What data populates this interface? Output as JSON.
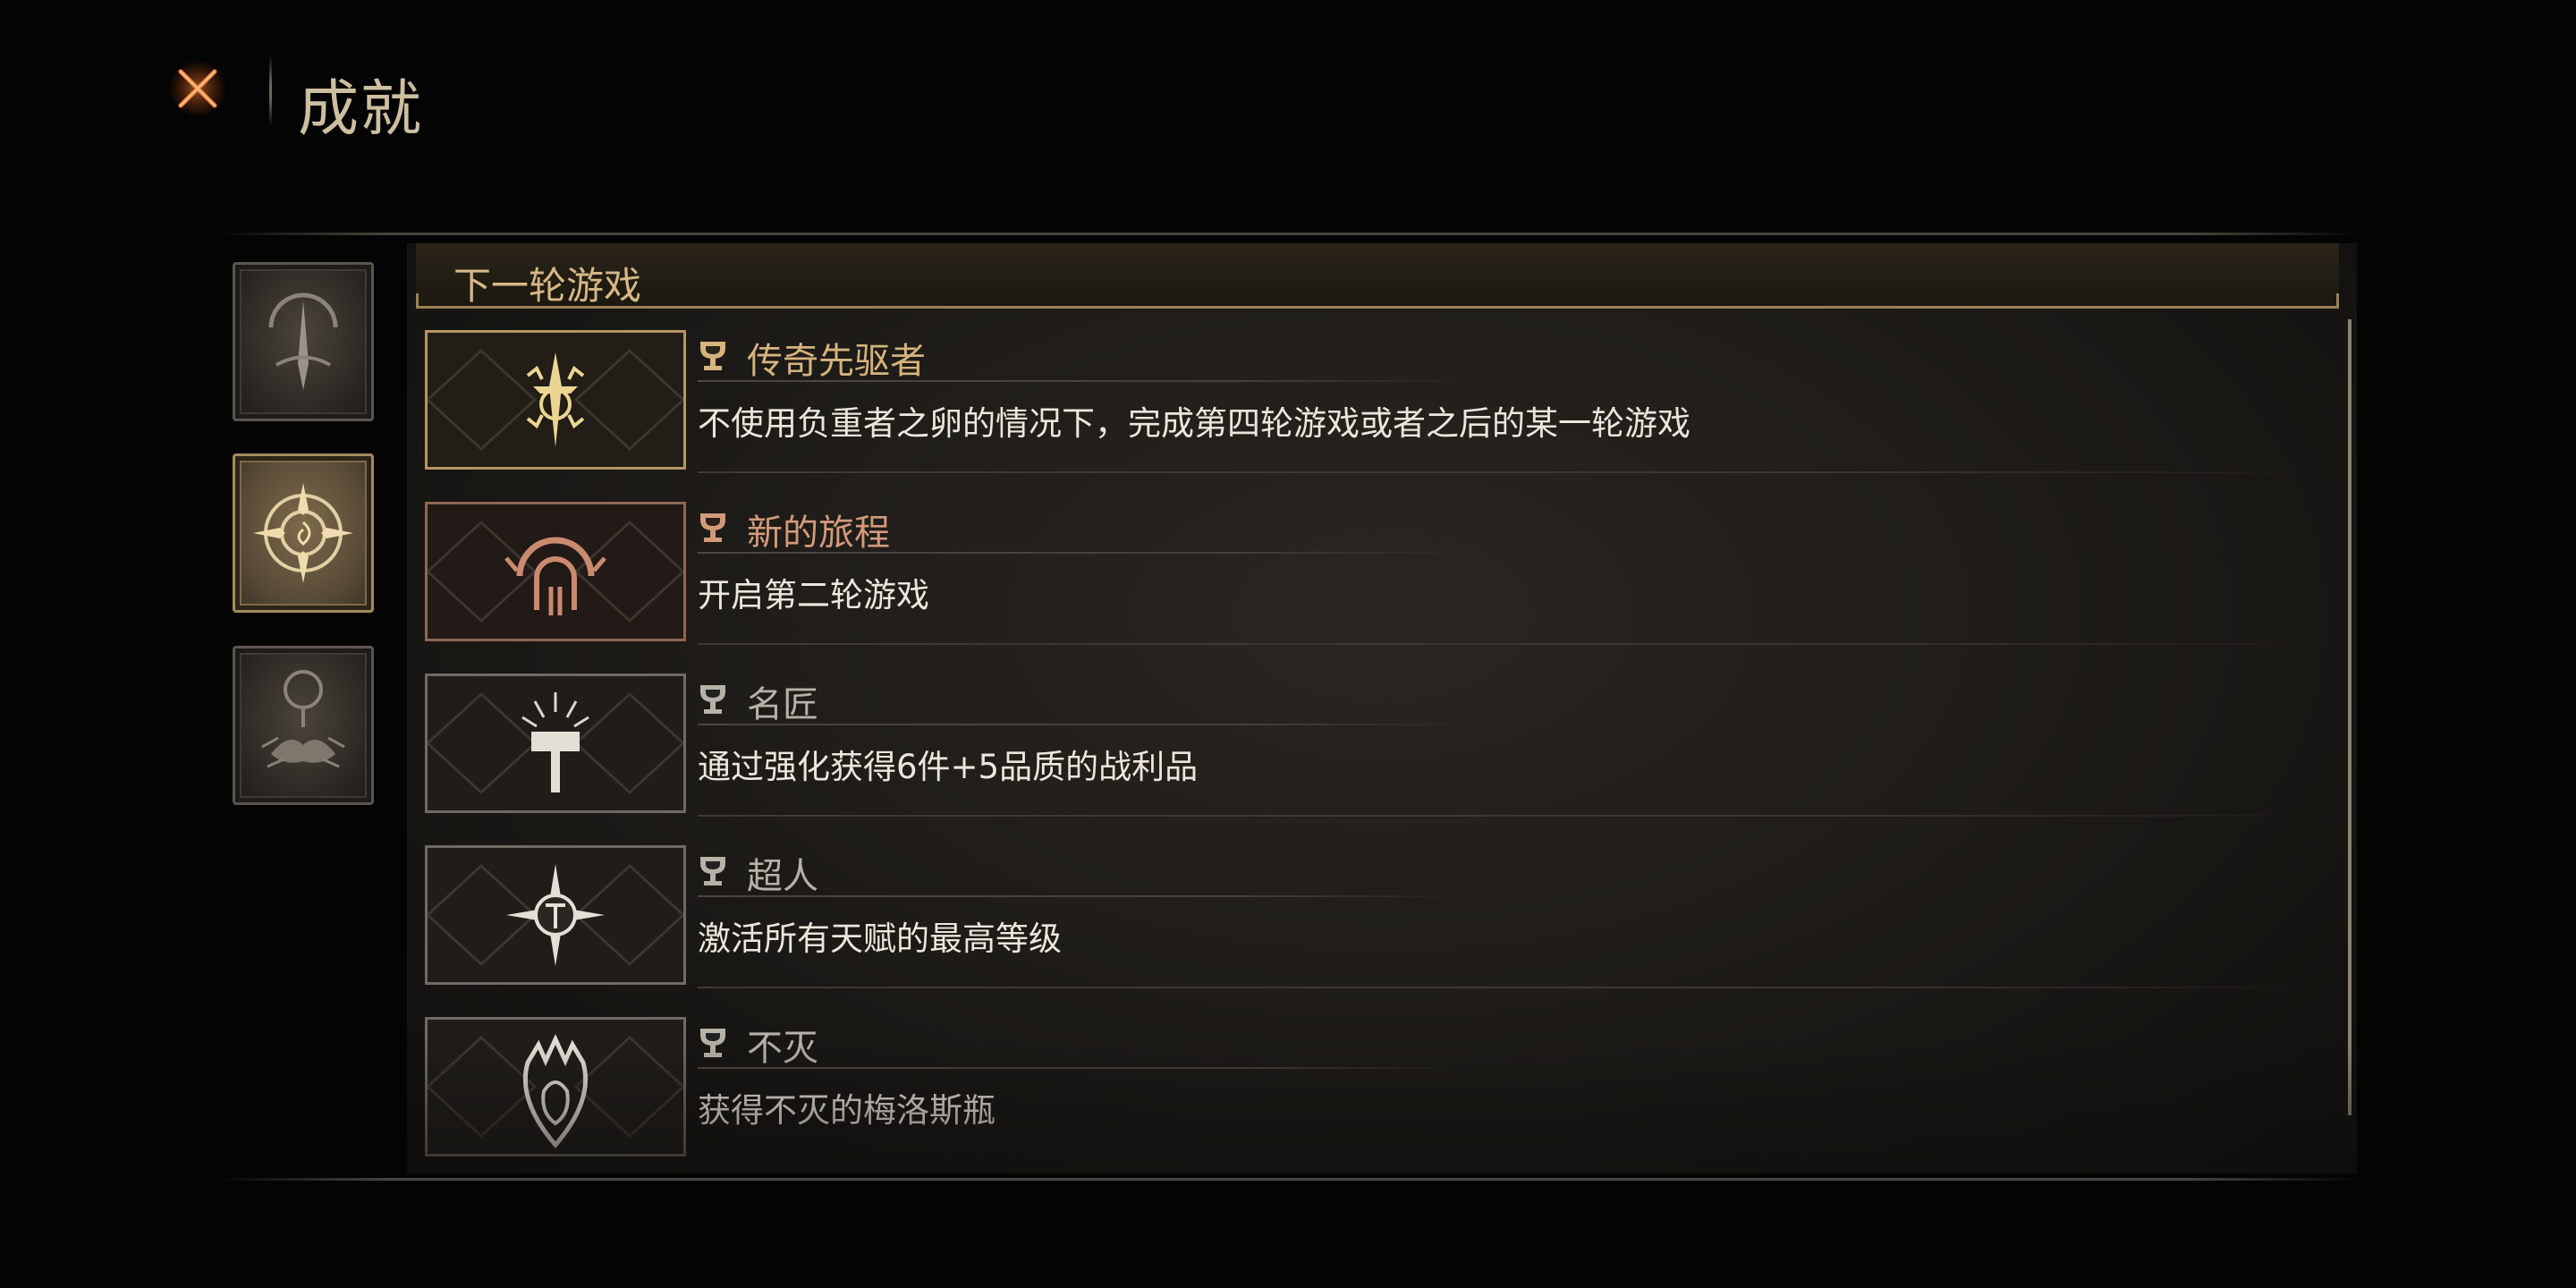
{
  "header": {
    "title": "成就"
  },
  "sidebar": {
    "tabs": [
      {
        "icon": "eye-blade-icon",
        "active": false
      },
      {
        "icon": "compass-sun-icon",
        "active": true
      },
      {
        "icon": "beast-altar-icon",
        "active": false
      }
    ]
  },
  "section": {
    "title": "下一轮游戏"
  },
  "achievements": [
    {
      "title": "传奇先驱者",
      "description": "不使用负重者之卵的情况下，完成第四轮游戏或者之后的某一轮游戏",
      "tier": "gold",
      "icon": "sword-sigil-icon"
    },
    {
      "title": "新的旅程",
      "description": "开启第二轮游戏",
      "tier": "bronze",
      "icon": "arch-gate-icon"
    },
    {
      "title": "名匠",
      "description": "通过强化获得6件+5品质的战利品",
      "tier": "silver",
      "icon": "hammer-burst-icon"
    },
    {
      "title": "超人",
      "description": "激活所有天赋的最高等级",
      "tier": "silver",
      "icon": "star-emblem-icon"
    },
    {
      "title": "不灭",
      "description": "获得不灭的梅洛斯瓶",
      "tier": "silver",
      "icon": "flame-flask-icon"
    }
  ],
  "colors": {
    "gold": "#d6b37c",
    "bronze": "#d39a7a",
    "silver": "#b7b1a8",
    "accent": "#e0622a"
  }
}
